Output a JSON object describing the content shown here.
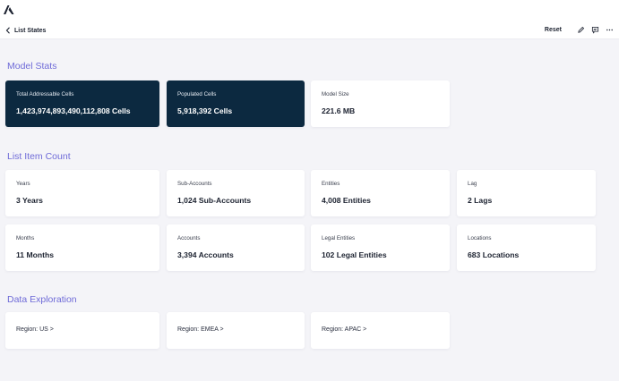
{
  "toolbar": {
    "back_label": "List States",
    "reset_label": "Reset"
  },
  "icons": {
    "logo": "anaplan-logo",
    "back": "chevron-left-icon",
    "edit": "pencil-icon",
    "comment": "comment-icon",
    "more": "more-horizontal-icon"
  },
  "colors": {
    "accent": "#6f6bd8",
    "dark_card": "#0c2940",
    "background": "#f4f4f8"
  },
  "model_stats": {
    "title": "Model Stats",
    "cards": [
      {
        "label": "Total Addressable Cells",
        "value": "1,423,974,893,490,112,808 Cells"
      },
      {
        "label": "Populated Cells",
        "value": "5,918,392 Cells"
      },
      {
        "label": "Model Size",
        "value": "221.6 MB"
      }
    ]
  },
  "list_item_count": {
    "title": "List Item Count",
    "cards": [
      {
        "label": "Years",
        "value": "3 Years"
      },
      {
        "label": "Sub-Accounts",
        "value": "1,024 Sub-Accounts"
      },
      {
        "label": "Entities",
        "value": "4,008 Entities"
      },
      {
        "label": "Lag",
        "value": "2 Lags"
      },
      {
        "label": "Months",
        "value": "11 Months"
      },
      {
        "label": "Accounts",
        "value": "3,394 Accounts"
      },
      {
        "label": "Legal Entities",
        "value": "102 Legal Entities"
      },
      {
        "label": "Locations",
        "value": "683 Locations"
      }
    ]
  },
  "data_exploration": {
    "title": "Data Exploration",
    "items": [
      {
        "label": "Region: US >"
      },
      {
        "label": "Region: EMEA >"
      },
      {
        "label": "Region: APAC >"
      }
    ]
  }
}
